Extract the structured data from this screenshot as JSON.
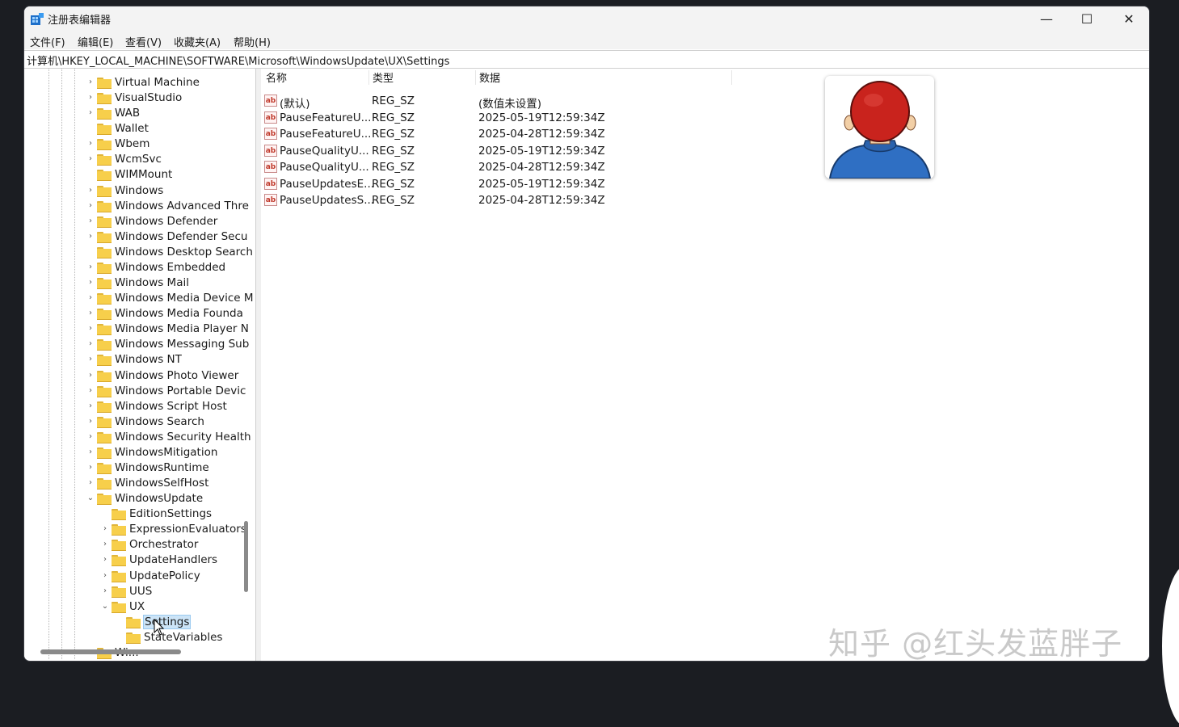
{
  "window": {
    "title": "注册表编辑器",
    "controls": {
      "minimize": "—",
      "maximize": "☐",
      "close": "✕"
    }
  },
  "menu": [
    "文件(F)",
    "编辑(E)",
    "查看(V)",
    "收藏夹(A)",
    "帮助(H)"
  ],
  "address": "计算机\\HKEY_LOCAL_MACHINE\\SOFTWARE\\Microsoft\\WindowsUpdate\\UX\\Settings",
  "tree": {
    "items": [
      {
        "label": "Virtual Machine",
        "level": 0,
        "chevron": "›"
      },
      {
        "label": "VisualStudio",
        "level": 0,
        "chevron": "›"
      },
      {
        "label": "WAB",
        "level": 0,
        "chevron": "›"
      },
      {
        "label": "Wallet",
        "level": 0,
        "chevron": ""
      },
      {
        "label": "Wbem",
        "level": 0,
        "chevron": "›"
      },
      {
        "label": "WcmSvc",
        "level": 0,
        "chevron": "›"
      },
      {
        "label": "WIMMount",
        "level": 0,
        "chevron": ""
      },
      {
        "label": "Windows",
        "level": 0,
        "chevron": "›"
      },
      {
        "label": "Windows Advanced Thre",
        "level": 0,
        "chevron": "›"
      },
      {
        "label": "Windows Defender",
        "level": 0,
        "chevron": "›"
      },
      {
        "label": "Windows Defender Secu",
        "level": 0,
        "chevron": "›"
      },
      {
        "label": "Windows Desktop Search",
        "level": 0,
        "chevron": ""
      },
      {
        "label": "Windows Embedded",
        "level": 0,
        "chevron": "›"
      },
      {
        "label": "Windows Mail",
        "level": 0,
        "chevron": "›"
      },
      {
        "label": "Windows Media Device M",
        "level": 0,
        "chevron": "›"
      },
      {
        "label": "Windows Media Founda",
        "level": 0,
        "chevron": "›"
      },
      {
        "label": "Windows Media Player N",
        "level": 0,
        "chevron": "›"
      },
      {
        "label": "Windows Messaging Sub",
        "level": 0,
        "chevron": "›"
      },
      {
        "label": "Windows NT",
        "level": 0,
        "chevron": "›"
      },
      {
        "label": "Windows Photo Viewer",
        "level": 0,
        "chevron": "›"
      },
      {
        "label": "Windows Portable Devic",
        "level": 0,
        "chevron": "›"
      },
      {
        "label": "Windows Script Host",
        "level": 0,
        "chevron": "›"
      },
      {
        "label": "Windows Search",
        "level": 0,
        "chevron": "›"
      },
      {
        "label": "Windows Security Health",
        "level": 0,
        "chevron": "›"
      },
      {
        "label": "WindowsMitigation",
        "level": 0,
        "chevron": "›"
      },
      {
        "label": "WindowsRuntime",
        "level": 0,
        "chevron": "›"
      },
      {
        "label": "WindowsSelfHost",
        "level": 0,
        "chevron": "›"
      },
      {
        "label": "WindowsUpdate",
        "level": 0,
        "chevron": "⌄"
      },
      {
        "label": "EditionSettings",
        "level": 1,
        "chevron": ""
      },
      {
        "label": "ExpressionEvaluators",
        "level": 1,
        "chevron": "›"
      },
      {
        "label": "Orchestrator",
        "level": 1,
        "chevron": "›"
      },
      {
        "label": "UpdateHandlers",
        "level": 1,
        "chevron": "›"
      },
      {
        "label": "UpdatePolicy",
        "level": 1,
        "chevron": "›"
      },
      {
        "label": "UUS",
        "level": 1,
        "chevron": "›"
      },
      {
        "label": "UX",
        "level": 1,
        "chevron": "⌄"
      },
      {
        "label": "Settings",
        "level": 2,
        "chevron": "",
        "selected": true
      },
      {
        "label": "StateVariables",
        "level": 2,
        "chevron": ""
      },
      {
        "label": "Wi...",
        "level": 0,
        "chevron": "›"
      }
    ]
  },
  "list": {
    "columns": [
      "名称",
      "类型",
      "数据"
    ],
    "rows": [
      {
        "icon": "ab",
        "name": "(默认)",
        "type": "REG_SZ",
        "data": "(数值未设置)"
      },
      {
        "icon": "ab",
        "name": "PauseFeatureU...",
        "type": "REG_SZ",
        "data": "2025-05-19T12:59:34Z"
      },
      {
        "icon": "ab",
        "name": "PauseFeatureU...",
        "type": "REG_SZ",
        "data": "2025-04-28T12:59:34Z"
      },
      {
        "icon": "ab",
        "name": "PauseQualityU...",
        "type": "REG_SZ",
        "data": "2025-05-19T12:59:34Z"
      },
      {
        "icon": "ab",
        "name": "PauseQualityU...",
        "type": "REG_SZ",
        "data": "2025-04-28T12:59:34Z"
      },
      {
        "icon": "ab",
        "name": "PauseUpdatesE...",
        "type": "REG_SZ",
        "data": "2025-05-19T12:59:34Z"
      },
      {
        "icon": "ab",
        "name": "PauseUpdatesS...",
        "type": "REG_SZ",
        "data": "2025-04-28T12:59:34Z"
      }
    ]
  },
  "watermark": "知乎 @红头发蓝胖子",
  "colors": {
    "folder": "#f7cf4b",
    "selection": "#cce4f7",
    "hair": "#c9231d",
    "shirt": "#2f6fc3"
  }
}
